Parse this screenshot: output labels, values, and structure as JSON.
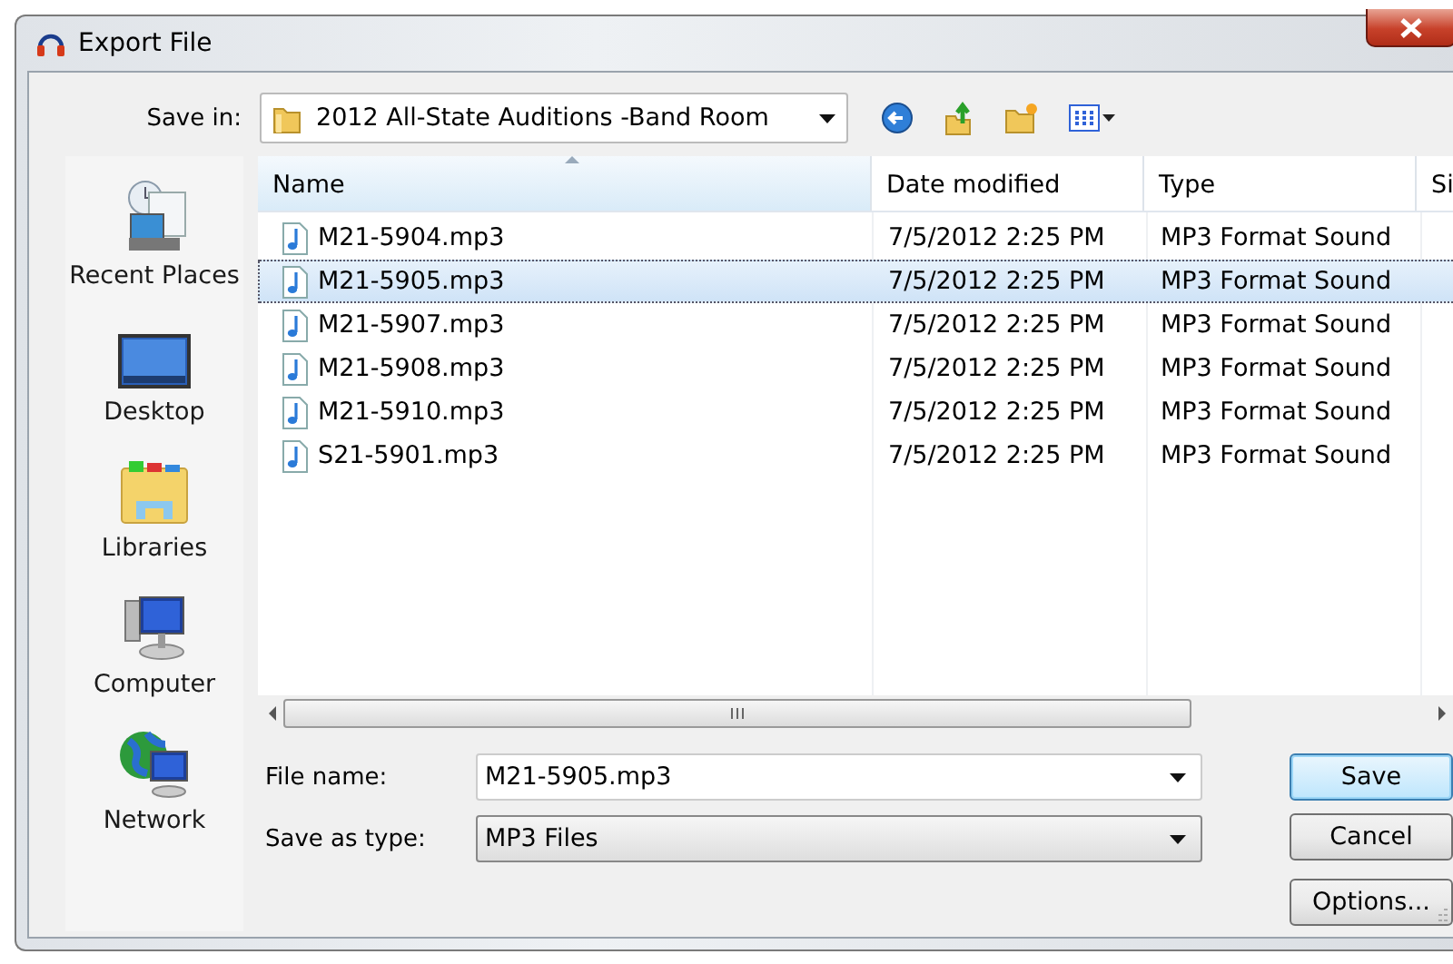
{
  "window": {
    "title": "Export File"
  },
  "save_in": {
    "label": "Save in:",
    "value": "2012 All-State Auditions -Band Room"
  },
  "sidebar": {
    "items": [
      {
        "label": "Recent Places",
        "kind": "recent"
      },
      {
        "label": "Desktop",
        "kind": "desktop"
      },
      {
        "label": "Libraries",
        "kind": "libraries"
      },
      {
        "label": "Computer",
        "kind": "computer"
      },
      {
        "label": "Network",
        "kind": "network"
      }
    ]
  },
  "table": {
    "columns": [
      {
        "label": "Name",
        "sorted": true
      },
      {
        "label": "Date modified",
        "sorted": false
      },
      {
        "label": "Type",
        "sorted": false
      },
      {
        "label": "Si",
        "sorted": false
      }
    ],
    "rows": [
      {
        "name": "M21-5904.mp3",
        "date": "7/5/2012 2:25 PM",
        "type": "MP3 Format Sound",
        "selected": false
      },
      {
        "name": "M21-5905.mp3",
        "date": "7/5/2012 2:25 PM",
        "type": "MP3 Format Sound",
        "selected": true
      },
      {
        "name": "M21-5907.mp3",
        "date": "7/5/2012 2:25 PM",
        "type": "MP3 Format Sound",
        "selected": false
      },
      {
        "name": "M21-5908.mp3",
        "date": "7/5/2012 2:25 PM",
        "type": "MP3 Format Sound",
        "selected": false
      },
      {
        "name": "M21-5910.mp3",
        "date": "7/5/2012 2:25 PM",
        "type": "MP3 Format Sound",
        "selected": false
      },
      {
        "name": "S21-5901.mp3",
        "date": "7/5/2012 2:25 PM",
        "type": "MP3 Format Sound",
        "selected": false
      }
    ]
  },
  "file_name": {
    "label": "File name:",
    "value": "M21-5905.mp3"
  },
  "save_as_type": {
    "label": "Save as type:",
    "value": "MP3 Files"
  },
  "buttons": [
    {
      "label": "Save",
      "default": true
    },
    {
      "label": "Cancel",
      "default": false
    },
    {
      "label": "Options...",
      "default": false
    }
  ]
}
